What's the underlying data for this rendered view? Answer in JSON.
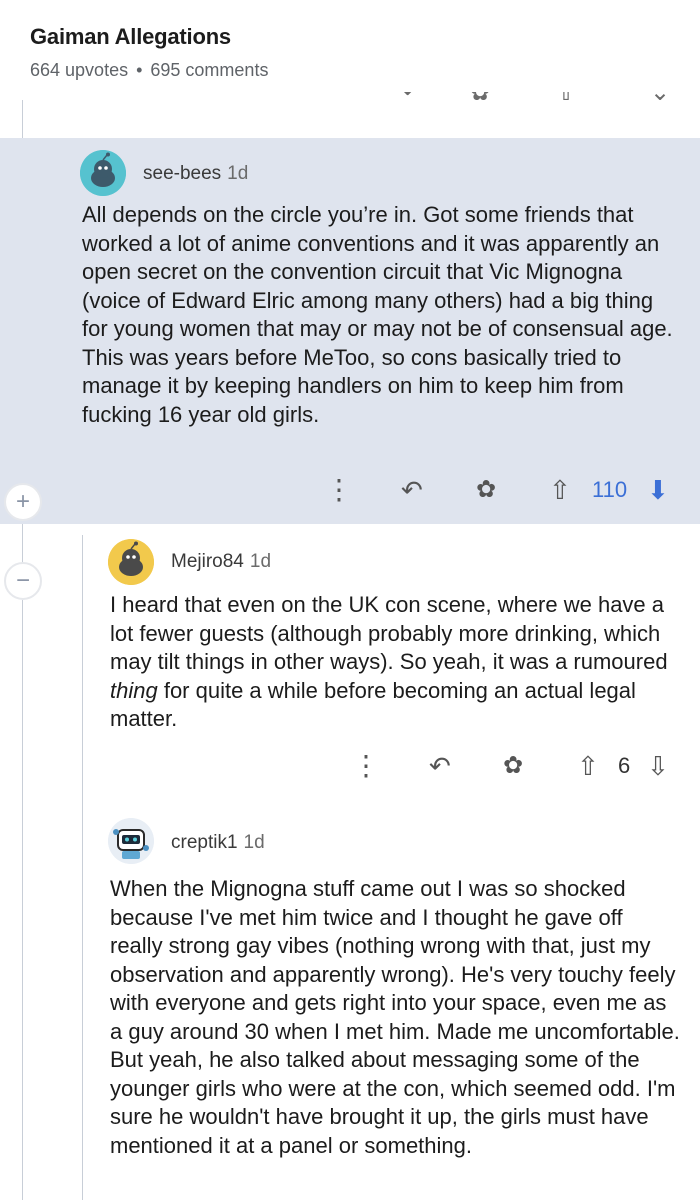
{
  "post": {
    "title": "Gaiman Allegations",
    "upvotes": "664 upvotes",
    "separator": "•",
    "comments": "695 comments"
  },
  "comments": [
    {
      "username": "see-bees",
      "age": "1d",
      "body": "All depends on the circle you’re in. Got some friends that worked a lot of anime conventions and it was apparently an open secret on the convention circuit that Vic Mignogna (voice of Edward Elric among many others) had a big thing for young women that may or may not be of consensual age. This was years before MeToo, so cons basically tried to manage it by keeping handlers on him to keep him from fucking 16 year old girls.",
      "score": "110",
      "avatar_color": "#56c2cf",
      "collapse_symbol": "+"
    },
    {
      "username": "Mejiro84",
      "age": "1d",
      "body_before": "I heard that even on the UK con scene, where we have a lot fewer guests (although probably more drinking, which may tilt things in other ways).  So yeah, it was a rumoured ",
      "body_em": "thing",
      "body_after": " for quite a while before becoming an actual legal matter.",
      "score": "6",
      "avatar_color": "#f2c94c",
      "collapse_symbol": "−"
    },
    {
      "username": "creptik1",
      "age": "1d",
      "body": "When the Mignogna stuff came out I was so shocked because I've met him twice and I thought he gave off really strong gay vibes (nothing wrong with that, just my observation and apparently wrong). He's very touchy feely with everyone and gets right into your space, even me as a guy around 30 when I met him. Made me uncomfortable. But yeah, he also talked about messaging some of the younger girls who were at the con, which seemed odd. I'm sure he wouldn't have brought it up, the girls must have mentioned it at a panel or something."
    }
  ],
  "colors": {
    "highlight_bg": "#dfe4ee",
    "upvote_active": "#3b6fd6",
    "downvote_active": "#3b6fd6"
  },
  "icons": [
    "more-icon",
    "reply-icon",
    "award-icon",
    "upvote-icon",
    "downvote-icon",
    "snoo-avatar-icon"
  ]
}
